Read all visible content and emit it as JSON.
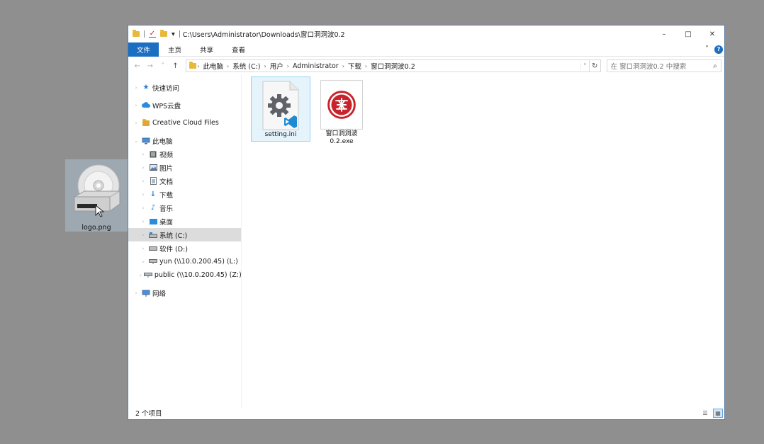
{
  "desktop": {
    "dragged_file": {
      "name": "logo.png",
      "icon": "disc-drive-icon"
    }
  },
  "window": {
    "title_path": "C:\\Users\\Administrator\\Downloads\\窗口洞洞波0.2",
    "controls": {
      "minimize": "–",
      "maximize": "□",
      "close": "✕"
    },
    "qat_dropdown": "▾"
  },
  "ribbon": {
    "tabs": [
      "文件",
      "主页",
      "共享",
      "查看"
    ],
    "collapse": "˅",
    "help": "?"
  },
  "nav": {
    "back": "←",
    "forward": "→",
    "recent": "˅",
    "up": "↑"
  },
  "address": {
    "crumbs": [
      "此电脑",
      "系统 (C:)",
      "用户",
      "Administrator",
      "下载",
      "窗口洞洞波0.2"
    ],
    "separator": "›",
    "dropdown": "˅",
    "refresh": "↻"
  },
  "search": {
    "placeholder": "在 窗口洞洞波0.2 中搜索",
    "icon": "⌕"
  },
  "sidebar": {
    "quick_access": "快速访问",
    "wps_cloud": "WPS云盘",
    "creative_cloud": "Creative Cloud Files",
    "this_pc": "此电脑",
    "items": [
      {
        "label": "视频",
        "icon": "video-icon"
      },
      {
        "label": "图片",
        "icon": "pictures-icon"
      },
      {
        "label": "文档",
        "icon": "documents-icon"
      },
      {
        "label": "下载",
        "icon": "downloads-icon"
      },
      {
        "label": "音乐",
        "icon": "music-icon"
      },
      {
        "label": "桌面",
        "icon": "desktop-icon"
      },
      {
        "label": "系统 (C:)",
        "icon": "system-drive-icon",
        "selected": true
      },
      {
        "label": "软件 (D:)",
        "icon": "drive-icon"
      },
      {
        "label": "yun (\\\\10.0.200.45) (L:)",
        "icon": "network-drive-icon"
      },
      {
        "label": "public (\\\\10.0.200.45) (Z:)",
        "icon": "network-drive-icon"
      }
    ],
    "network": "网络"
  },
  "files": [
    {
      "name": "setting.ini",
      "icon": "ini-settings-file-icon",
      "selected": true
    },
    {
      "name": "窗口洞洞波 0.2.exe",
      "icon": "app-seal-icon",
      "line1": "窗口洞洞波",
      "line2": "0.2.exe"
    }
  ],
  "status": {
    "count": "2 个项目",
    "view_details": "☰",
    "view_icons": "▦"
  },
  "colors": {
    "accent": "#1b6ec2",
    "selection": "#e5f3fb",
    "sidebar_selected": "#dcdcdc",
    "seal_red": "#c8232c"
  }
}
